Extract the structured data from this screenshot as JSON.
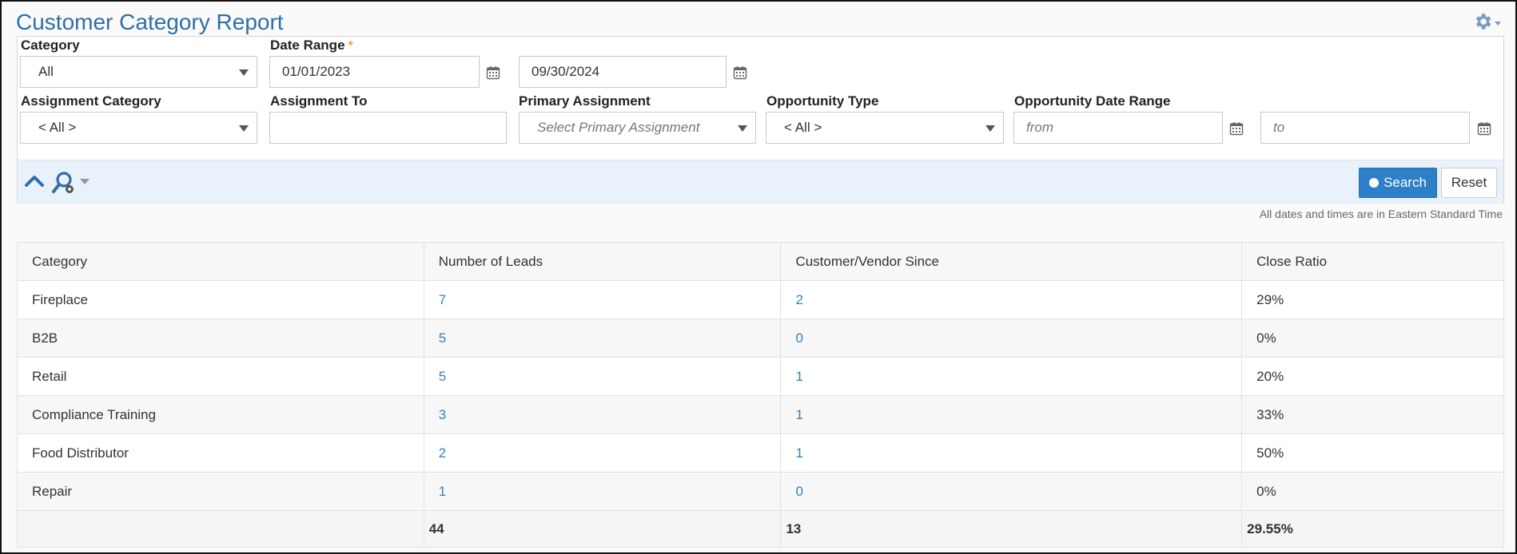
{
  "header": {
    "title": "Customer Category Report",
    "settings_icon": "gear-icon"
  },
  "filters": {
    "category": {
      "label": "Category",
      "value": "All"
    },
    "date_range": {
      "label": "Date Range",
      "required_mark": "*",
      "start": "01/01/2023",
      "end": "09/30/2024"
    },
    "assignment_category": {
      "label": "Assignment Category",
      "value": "< All >"
    },
    "assignment_to": {
      "label": "Assignment To",
      "value": ""
    },
    "primary_assignment": {
      "label": "Primary Assignment",
      "placeholder": "Select Primary Assignment"
    },
    "opportunity_type": {
      "label": "Opportunity Type",
      "value": "< All >"
    },
    "opportunity_date_range": {
      "label": "Opportunity Date Range",
      "from_placeholder": "from",
      "to_placeholder": "to"
    }
  },
  "toolbar": {
    "search_label": "Search",
    "reset_label": "Reset"
  },
  "timezone_note": "All dates and times are in Eastern Standard Time",
  "table": {
    "columns": [
      "Category",
      "Number of Leads",
      "Customer/Vendor Since",
      "Close Ratio"
    ],
    "rows": [
      {
        "category": "Fireplace",
        "leads": "7",
        "since": "2",
        "ratio": "29%"
      },
      {
        "category": "B2B",
        "leads": "5",
        "since": "0",
        "ratio": "0%"
      },
      {
        "category": "Retail",
        "leads": "5",
        "since": "1",
        "ratio": "20%"
      },
      {
        "category": "Compliance Training",
        "leads": "3",
        "since": "1",
        "ratio": "33%"
      },
      {
        "category": "Food Distributor",
        "leads": "2",
        "since": "1",
        "ratio": "50%"
      },
      {
        "category": "Repair",
        "leads": "1",
        "since": "0",
        "ratio": "0%"
      }
    ],
    "totals": {
      "category": "",
      "leads": "44",
      "since": "13",
      "ratio": "29.55%"
    }
  },
  "colors": {
    "accent": "#2f6ea6",
    "link": "#3a7fb8",
    "primary_button": "#2f7fc8",
    "toolbar_bg": "#e9f1fa"
  }
}
